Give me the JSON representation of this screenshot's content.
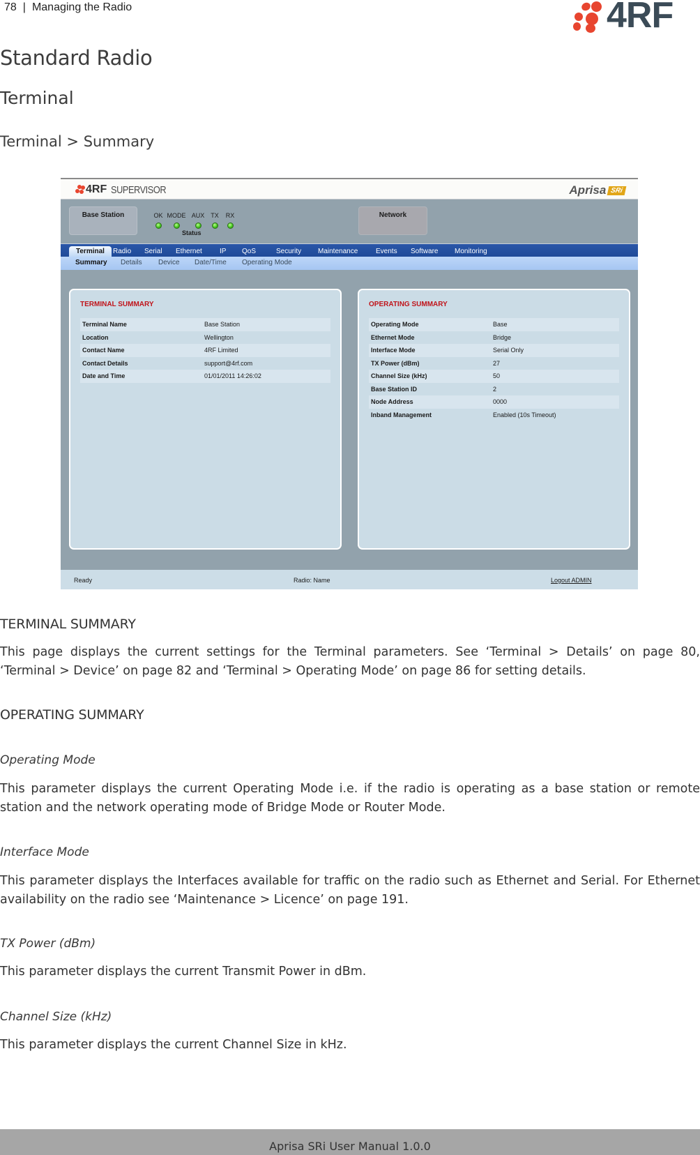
{
  "running_head": {
    "page_number": "78",
    "separator": "|",
    "chapter": "Managing the Radio"
  },
  "brand_logo": {
    "wordmark": "4RF",
    "dot_color": "#e8452f",
    "text_color": "#3b4b57"
  },
  "headings": {
    "h1": "Standard Radio",
    "h2": "Terminal",
    "h3": "Terminal > Summary"
  },
  "app": {
    "header": {
      "brand": "4RF",
      "product": "SUPERVISOR",
      "model_name": "Aprisa",
      "model_badge": "SRi"
    },
    "station_box": "Base Station",
    "network_box": "Network",
    "status_leds": [
      {
        "label": "OK",
        "state": "green"
      },
      {
        "label": "MODE",
        "state": "green"
      },
      {
        "label": "AUX",
        "state": "green"
      },
      {
        "label": "TX",
        "state": "green"
      },
      {
        "label": "RX",
        "state": "green"
      }
    ],
    "status_label": "Status",
    "tabs": [
      {
        "label": "Terminal",
        "active": true
      },
      {
        "label": "Radio"
      },
      {
        "label": "Serial"
      },
      {
        "label": "Ethernet"
      },
      {
        "label": "IP"
      },
      {
        "label": "QoS"
      },
      {
        "label": "Security"
      },
      {
        "label": "Maintenance"
      },
      {
        "label": "Events"
      },
      {
        "label": "Software"
      },
      {
        "label": "Monitoring"
      }
    ],
    "subtabs": [
      {
        "label": "Summary",
        "active": true
      },
      {
        "label": "Details"
      },
      {
        "label": "Device"
      },
      {
        "label": "Date/Time"
      },
      {
        "label": "Operating Mode"
      }
    ],
    "terminal_summary": {
      "title": "TERMINAL SUMMARY",
      "rows": [
        {
          "key": "Terminal Name",
          "value": "Base Station"
        },
        {
          "key": "Location",
          "value": "Wellington"
        },
        {
          "key": "Contact Name",
          "value": "4RF Limited"
        },
        {
          "key": "Contact Details",
          "value": "support@4rf.com"
        },
        {
          "key": "Date and Time",
          "value": "01/01/2011 14:26:02"
        }
      ]
    },
    "operating_summary": {
      "title": "OPERATING SUMMARY",
      "rows": [
        {
          "key": "Operating Mode",
          "value": "Base"
        },
        {
          "key": "Ethernet Mode",
          "value": "Bridge"
        },
        {
          "key": "Interface Mode",
          "value": "Serial Only"
        },
        {
          "key": "TX Power (dBm)",
          "value": "27"
        },
        {
          "key": "Channel Size (kHz)",
          "value": "50"
        },
        {
          "key": "Base Station ID",
          "value": "2"
        },
        {
          "key": "Node Address",
          "value": "0000"
        },
        {
          "key": "Inband Management",
          "value": "Enabled (10s Timeout)"
        }
      ]
    },
    "status_bar": {
      "state": "Ready",
      "radio_name": "Radio: Name",
      "logout": "Logout ADMIN"
    }
  },
  "body": {
    "terminal_summary_heading": "TERMINAL SUMMARY",
    "terminal_summary_text": "This page displays the current settings for the Terminal parameters. See ‘Terminal > Details’ on page 80, ‘Terminal > Device’ on page 82 and ‘Terminal > Operating Mode’ on page 86 for setting details.",
    "operating_summary_heading": "OPERATING SUMMARY",
    "params": [
      {
        "title": "Operating Mode",
        "text": "This parameter displays the current Operating Mode i.e. if the radio is operating as a base station or remote station and the network operating mode of Bridge Mode or Router Mode."
      },
      {
        "title": "Interface Mode",
        "text": "This parameter displays the Interfaces available for traffic on the radio such as Ethernet and Serial. For Ethernet availability on the radio see ‘Maintenance > Licence’ on page 191."
      },
      {
        "title": "TX Power (dBm)",
        "text": "This parameter displays the current Transmit Power in dBm."
      },
      {
        "title": "Channel Size (kHz)",
        "text": "This parameter displays the current Channel Size in kHz."
      }
    ]
  },
  "footer": {
    "text": "Aprisa SRi User Manual 1.0.0"
  }
}
